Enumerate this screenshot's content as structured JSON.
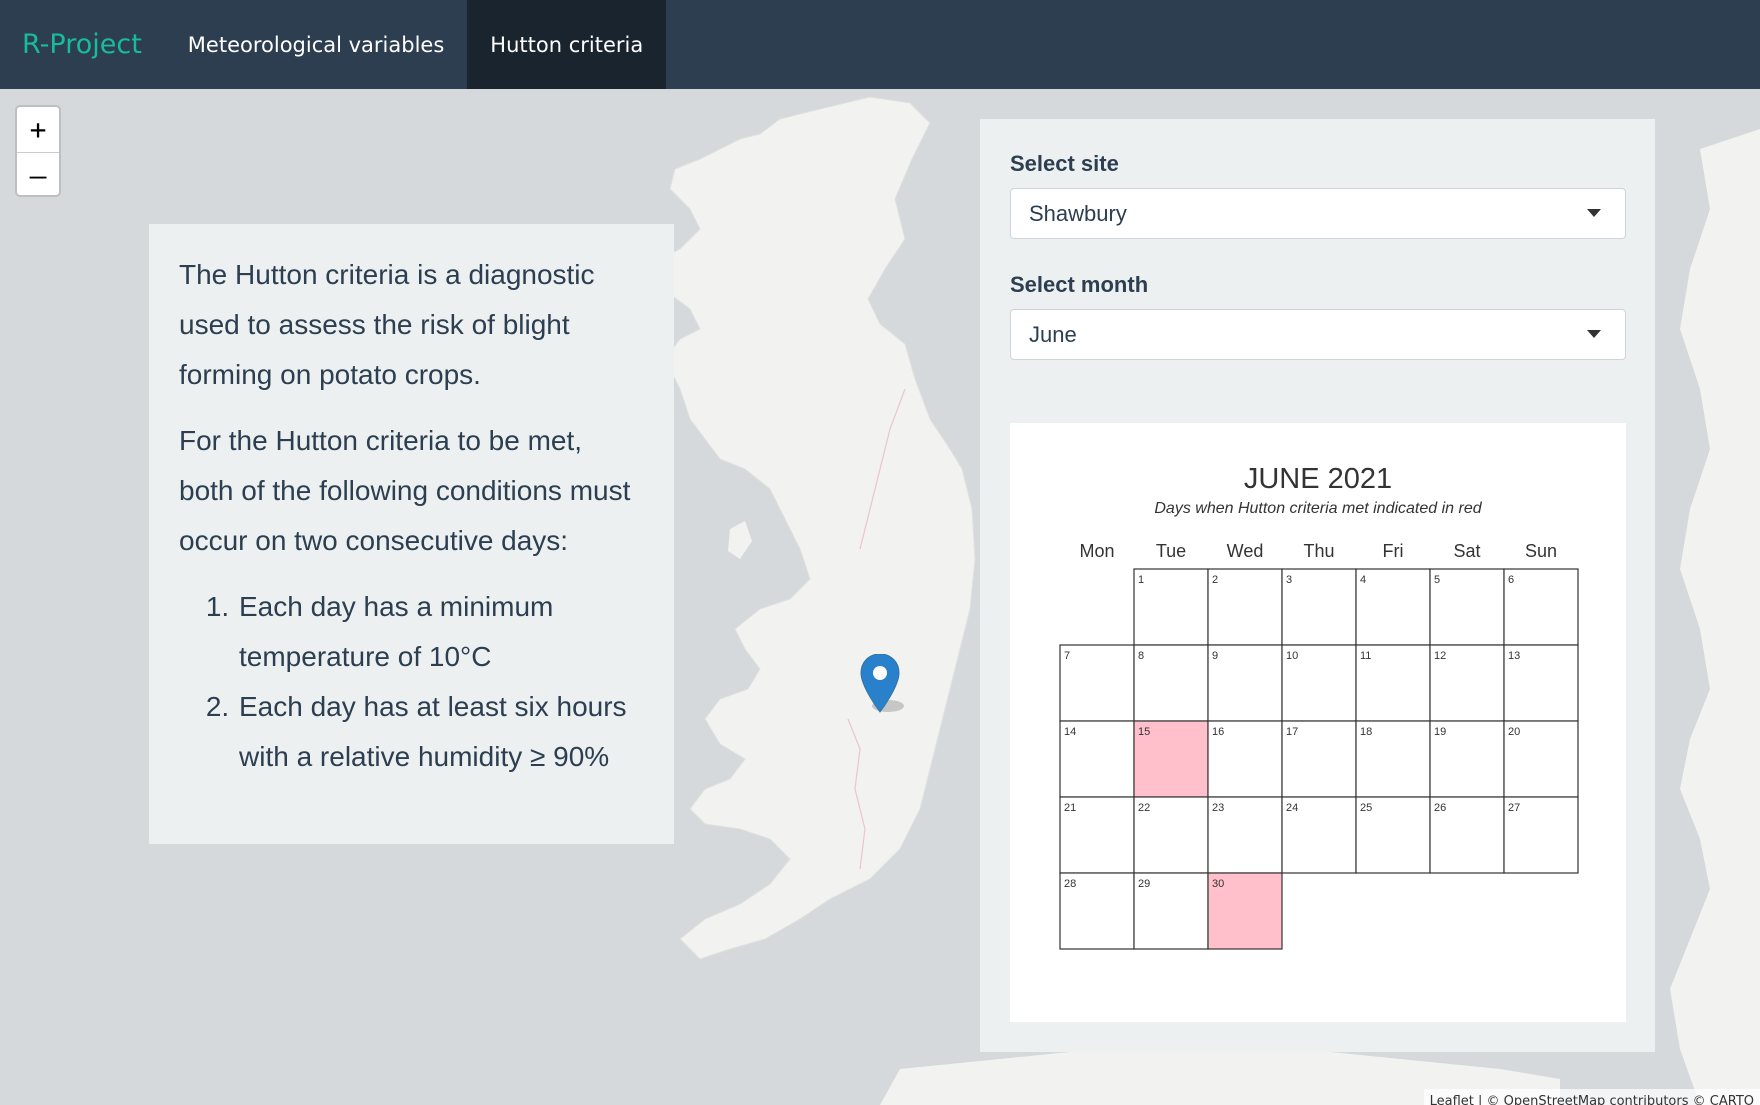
{
  "navbar": {
    "brand": "R-Project",
    "tabs": [
      {
        "label": "Meteorological variables",
        "active": false
      },
      {
        "label": "Hutton criteria",
        "active": true
      }
    ]
  },
  "map": {
    "zoom_in": "+",
    "zoom_out": "–",
    "marker_icon": "map-pin-icon",
    "attribution": "Leaflet | © OpenStreetMap contributors © CARTO"
  },
  "info": {
    "intro": "The Hutton criteria is a diagnostic used to assess the risk of blight forming on potato crops.",
    "conditions_intro": "For the Hutton criteria to be met, both of the following conditions must occur on two consecutive days:",
    "conditions": [
      "Each day has a minimum temperature of 10°C",
      "Each day has at least six hours with a relative humidity ≥ 90%"
    ]
  },
  "controls": {
    "site_label": "Select site",
    "site_value": "Shawbury",
    "month_label": "Select month",
    "month_value": "June"
  },
  "colors": {
    "navbar_bg": "#2c3e50",
    "navbar_active": "#1a242f",
    "brand": "#18bc9c",
    "panel_bg": "#ecf0f1",
    "hutton_met": "#ffc0cb",
    "map_water": "#d5d9dc",
    "map_land": "#f2f2f1"
  },
  "chart_data": {
    "type": "table",
    "title": "JUNE 2021",
    "subtitle": "Days when Hutton criteria met indicated in red",
    "weekdays": [
      "Mon",
      "Tue",
      "Wed",
      "Thu",
      "Fri",
      "Sat",
      "Sun"
    ],
    "first_weekday_index": 1,
    "days_in_month": 30,
    "hutton_met_days": [
      15,
      30
    ]
  }
}
